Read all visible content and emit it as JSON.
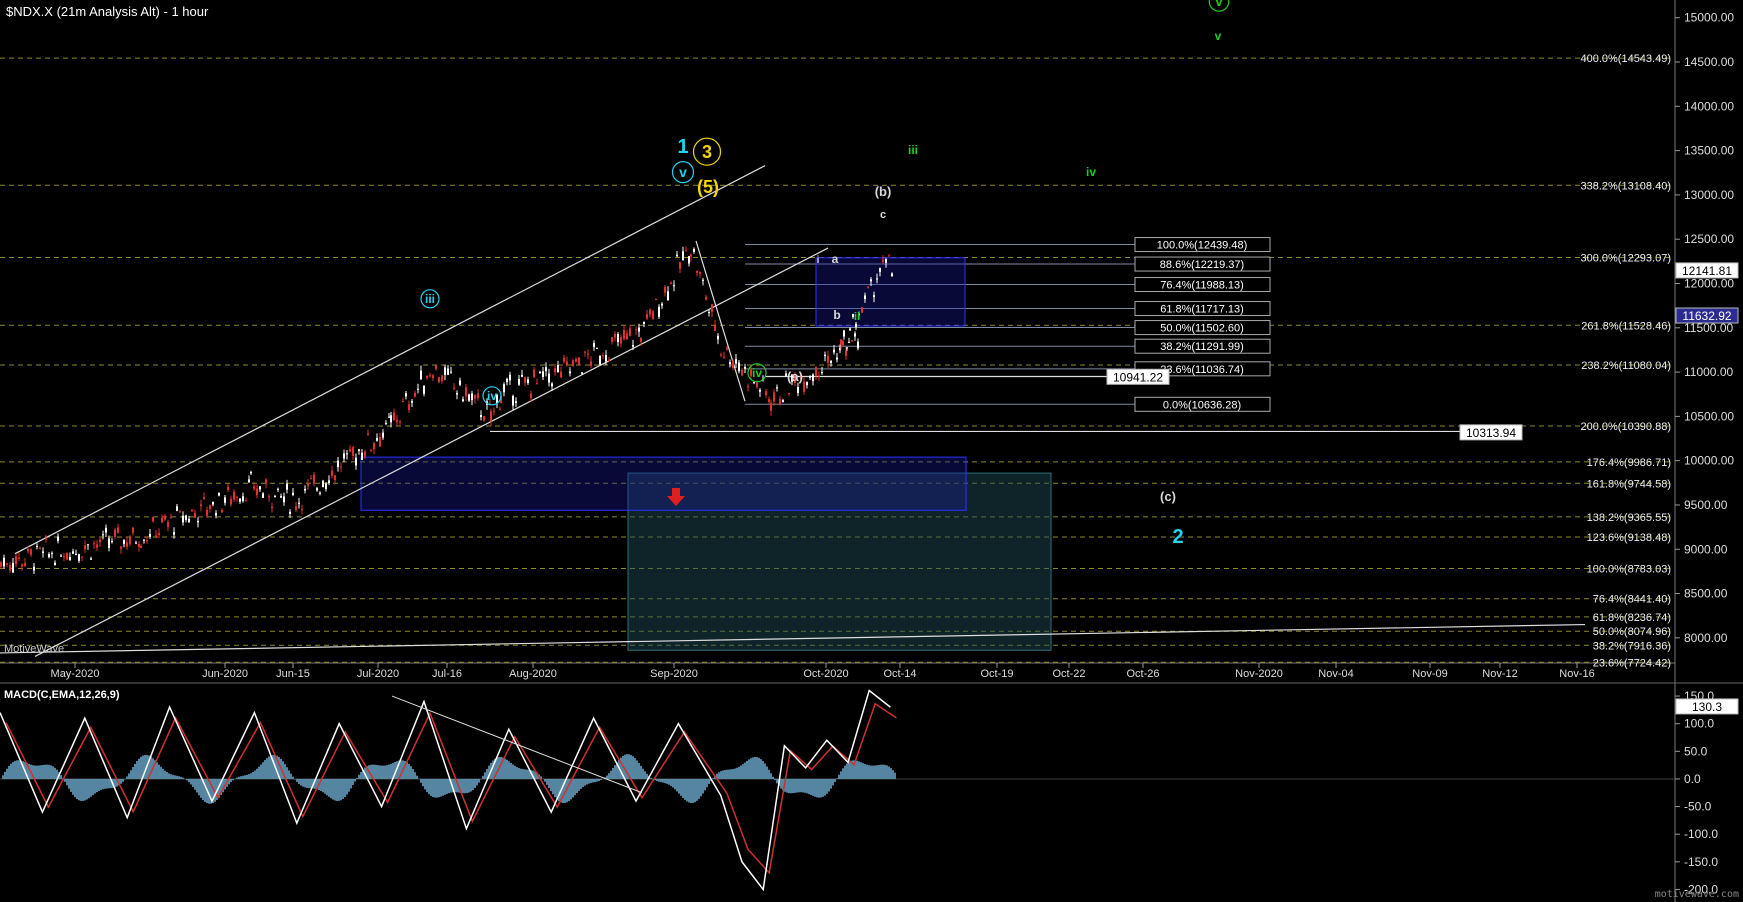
{
  "header": {
    "title": "$NDX.X (21m Analysis Alt) - 1 hour",
    "macd_title": "MACD(C,EMA,12,26,9)",
    "brand": "MotiveWave",
    "watermark": "motivewave.com"
  },
  "colors": {
    "background": "#000000",
    "candle_up": "#ffffff",
    "candle_down": "#e03030",
    "macd_line": "#ffffff",
    "signal_line": "#d03030",
    "histogram": "#6aa6c8",
    "fib_box": "#1a1aa0",
    "target_box": "#1f4f5a",
    "wave_cyan": "#23d3ee",
    "wave_yellow": "#f2d600",
    "wave_green": "#22cc22",
    "wave_white": "#d8d8d8"
  },
  "chart_data": [
    {
      "type": "line",
      "title": "$NDX.X (21m Analysis Alt) - 1 hour",
      "x_tick_labels": [
        "May-2020",
        "Jun-2020",
        "Jun-15",
        "Jul-2020",
        "Jul-16",
        "Aug-2020",
        "Sep-2020",
        "Oct-2020",
        "Oct-14",
        "Oct-19",
        "Oct-22",
        "Oct-26",
        "Nov-2020",
        "Nov-04",
        "Nov-09",
        "Nov-12",
        "Nov-16"
      ],
      "y_tick_labels": [
        "15000.00",
        "14500.00",
        "14000.00",
        "13500.00",
        "13000.00",
        "12500.00",
        "12000.00",
        "11500.00",
        "11000.00",
        "10500.00",
        "10000.00",
        "9500.00",
        "9000.00",
        "8500.00",
        "8000.00"
      ],
      "ylim": [
        7750,
        15200
      ],
      "price_path": [
        [
          "May-2020",
          8850
        ],
        [
          "May-2020",
          9150
        ],
        [
          "Jun-2020",
          9700
        ],
        [
          "Jun-15",
          9550
        ],
        [
          "Jul-2020",
          10400
        ],
        [
          "Jul-2020",
          11050
        ],
        [
          "Jul-16",
          10500
        ],
        [
          "Jul-16",
          10750
        ],
        [
          "Aug-2020",
          11000
        ],
        [
          "Aug-2020",
          11450
        ],
        [
          "Sep-2020",
          12420
        ],
        [
          "Sep-2020",
          11300
        ],
        [
          "Sep-2020",
          10700
        ],
        [
          "Oct-2020",
          11400
        ],
        [
          "Oct-2020",
          11250
        ],
        [
          "Oct-14",
          12200
        ],
        [
          "Oct-14",
          12140
        ]
      ],
      "price_last": "12141.81",
      "price_marker_2": "11632.92",
      "level_tags": [
        "10941.22",
        "10313.94"
      ],
      "ext_fibs": [
        {
          "label": "400.0%(14543.49)",
          "value": 14543.49
        },
        {
          "label": "338.2%(13108.40)",
          "value": 13108.4
        },
        {
          "label": "300.0%(12293.07)",
          "value": 12293.07
        },
        {
          "label": "261.8%(11528.46)",
          "value": 11528.46
        },
        {
          "label": "238.2%(11080.04)",
          "value": 11080.04
        },
        {
          "label": "200.0%(10390.88)",
          "value": 10390.88
        },
        {
          "label": "176.4%(9986.71)",
          "value": 9986.71
        },
        {
          "label": "161.8%(9744.58)",
          "value": 9744.58
        },
        {
          "label": "138.2%(9365.55)",
          "value": 9365.55
        },
        {
          "label": "123.6%(9138.48)",
          "value": 9138.48
        },
        {
          "label": "100.0%(8783.03)",
          "value": 8783.03
        },
        {
          "label": "76.4%(8441.40)",
          "value": 8441.4
        },
        {
          "label": "61.8%(8236.74)",
          "value": 8236.74
        },
        {
          "label": "50.0%(8074.96)",
          "value": 8074.96
        },
        {
          "label": "38.2%(7916.36)",
          "value": 7916.36
        },
        {
          "label": "23.6%(7724.42)",
          "value": 7724.42
        }
      ],
      "ret_fibs": [
        {
          "label": "100.0%(12439.48)",
          "value": 12439.48
        },
        {
          "label": "88.6%(12219.37)",
          "value": 12219.37
        },
        {
          "label": "76.4%(11988.13)",
          "value": 11988.13
        },
        {
          "label": "61.8%(11717.13)",
          "value": 11717.13
        },
        {
          "label": "50.0%(11502.60)",
          "value": 11502.6
        },
        {
          "label": "38.2%(11291.99)",
          "value": 11291.99
        },
        {
          "label": "23.6%(11036.74)",
          "value": 11036.74
        },
        {
          "label": "0.0%(10636.28)",
          "value": 10636.28
        }
      ],
      "wave_labels": [
        {
          "text": "1",
          "color": "cyan"
        },
        {
          "text": "3",
          "color": "yellow",
          "circled": true
        },
        {
          "text": "v",
          "color": "cyan",
          "circled": true
        },
        {
          "text": "(5)",
          "color": "yellow"
        },
        {
          "text": "iii",
          "color": "cyan",
          "circled": true
        },
        {
          "text": "iv",
          "color": "cyan",
          "circled": true
        },
        {
          "text": "iv",
          "color": "green",
          "circled": true
        },
        {
          "text": "(a)",
          "color": "white"
        },
        {
          "text": "(b)",
          "color": "white"
        },
        {
          "text": "c",
          "color": "white"
        },
        {
          "text": "a",
          "color": "white"
        },
        {
          "text": "b",
          "color": "white"
        },
        {
          "text": "i",
          "color": "white"
        },
        {
          "text": "ii",
          "color": "green"
        },
        {
          "text": "iii",
          "color": "green"
        },
        {
          "text": "iv",
          "color": "green"
        },
        {
          "text": "v",
          "color": "green"
        },
        {
          "text": "v",
          "color": "green",
          "circled": true
        },
        {
          "text": "(c)",
          "color": "white"
        },
        {
          "text": "2",
          "color": "cyan"
        }
      ]
    },
    {
      "type": "line",
      "title": "MACD(C,EMA,12,26,9)",
      "y_tick_labels": [
        "150.0",
        "100.0",
        "50.0",
        "0.0",
        "-50.0",
        "-100.0",
        "-150.0",
        "-200.0"
      ],
      "ylim": [
        -210,
        170
      ],
      "last_value": "130.3",
      "macd_path": [
        [
          0,
          120
        ],
        [
          40,
          -60
        ],
        [
          80,
          110
        ],
        [
          120,
          -70
        ],
        [
          160,
          130
        ],
        [
          200,
          -40
        ],
        [
          240,
          120
        ],
        [
          280,
          -80
        ],
        [
          320,
          100
        ],
        [
          360,
          -50
        ],
        [
          400,
          140
        ],
        [
          440,
          -90
        ],
        [
          480,
          90
        ],
        [
          520,
          -60
        ],
        [
          560,
          110
        ],
        [
          600,
          -40
        ],
        [
          640,
          100
        ],
        [
          680,
          -30
        ],
        [
          700,
          -150
        ],
        [
          720,
          -200
        ],
        [
          740,
          60
        ],
        [
          760,
          20
        ],
        [
          780,
          70
        ],
        [
          800,
          30
        ],
        [
          820,
          160
        ],
        [
          840,
          130
        ]
      ]
    }
  ]
}
